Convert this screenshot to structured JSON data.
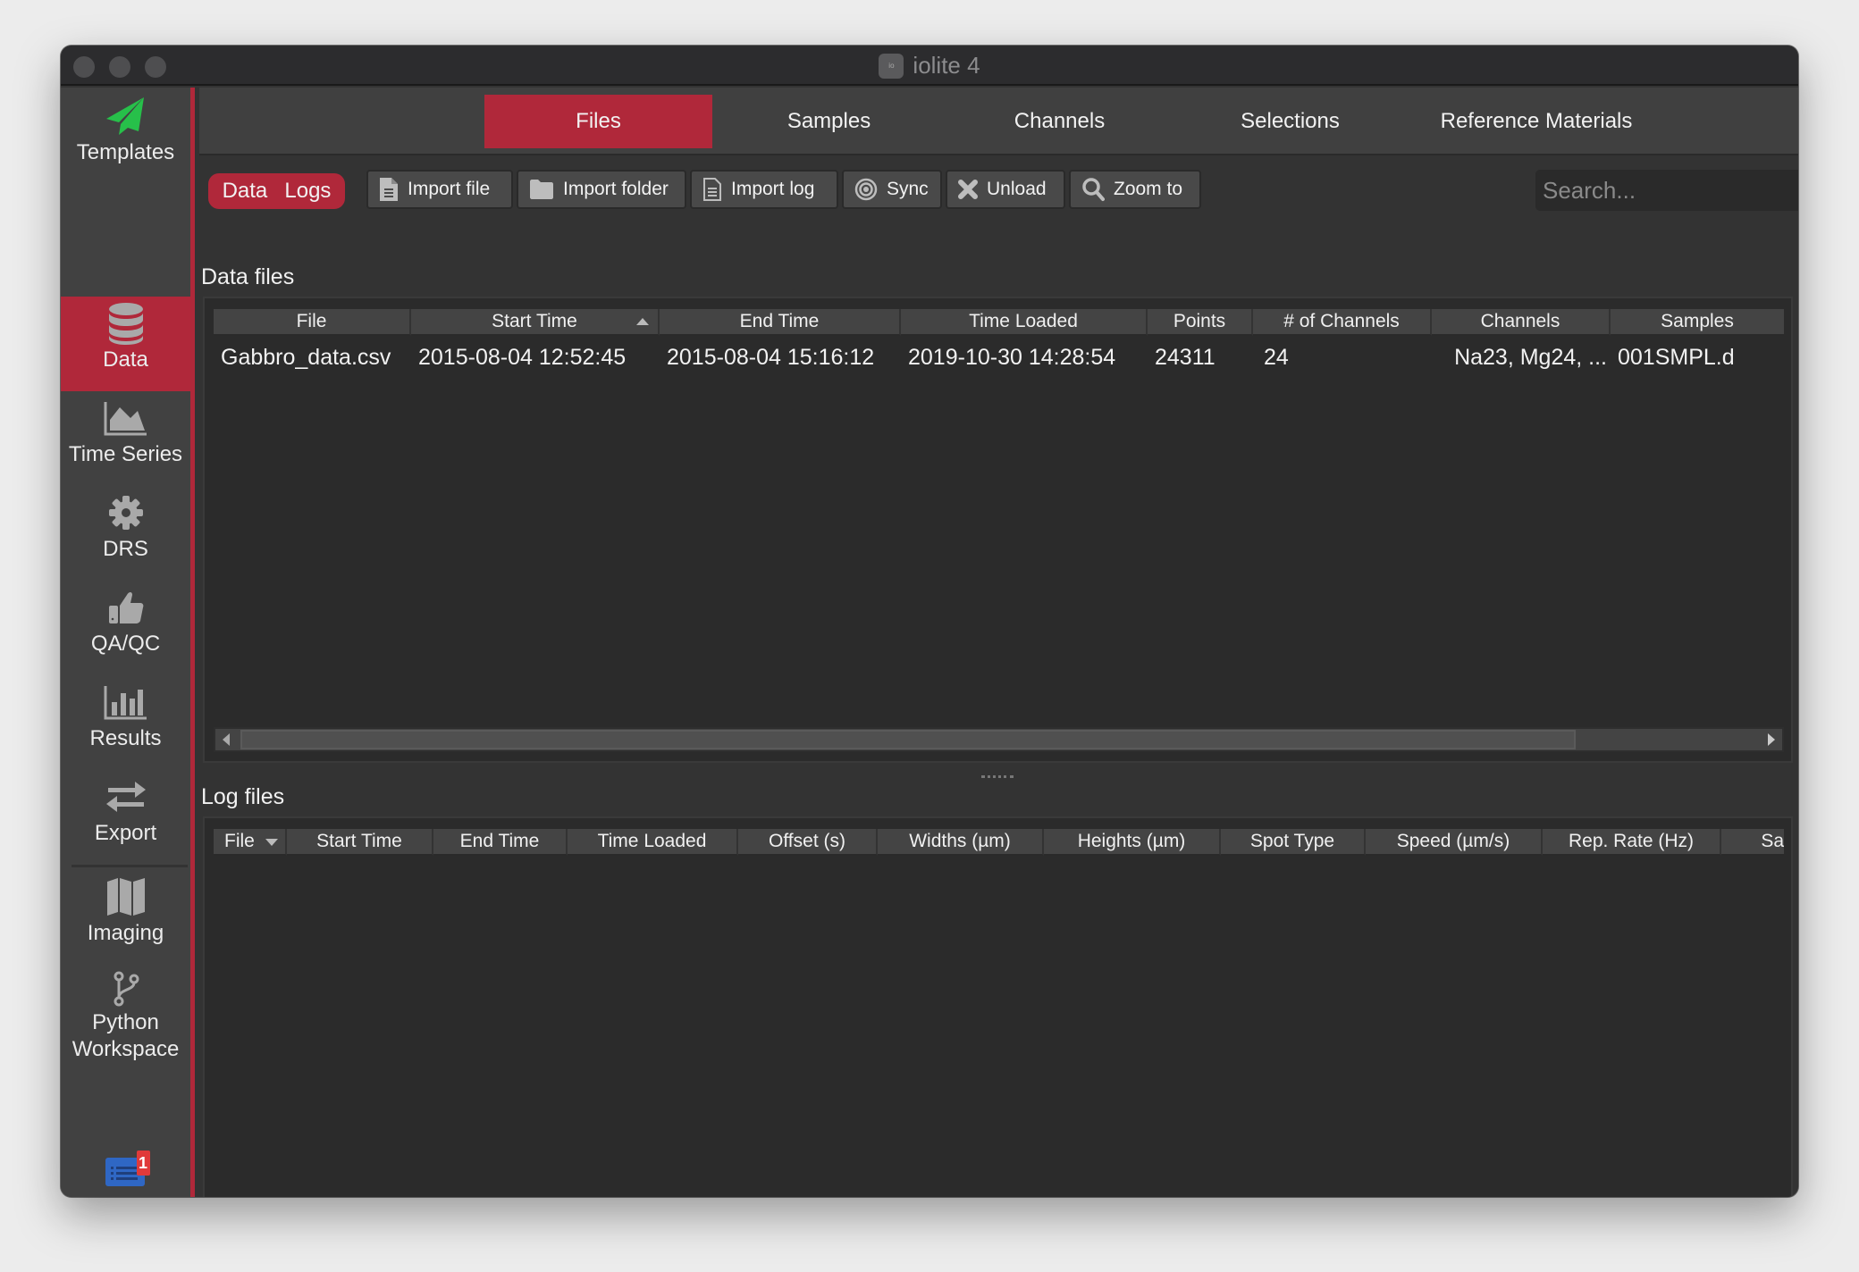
{
  "window": {
    "title": "iolite 4"
  },
  "sidebar": {
    "items": [
      {
        "id": "templates",
        "label": "Templates",
        "icon": "paper-plane-icon",
        "active": false
      },
      {
        "id": "data",
        "label": "Data",
        "icon": "database-icon",
        "active": true
      },
      {
        "id": "time-series",
        "label": "Time Series",
        "icon": "area-chart-icon",
        "active": false
      },
      {
        "id": "drs",
        "label": "DRS",
        "icon": "gear-icon",
        "active": false
      },
      {
        "id": "qaqc",
        "label": "QA/QC",
        "icon": "thumbs-up-icon",
        "active": false
      },
      {
        "id": "results",
        "label": "Results",
        "icon": "bar-chart-icon",
        "active": false
      },
      {
        "id": "export",
        "label": "Export",
        "icon": "exchange-arrows-icon",
        "active": false
      },
      {
        "id": "imaging",
        "label": "Imaging",
        "icon": "map-icon",
        "active": false
      },
      {
        "id": "python",
        "label": "Python Workspace",
        "label_line1": "Python",
        "label_line2": "Workspace",
        "icon": "code-branch-icon",
        "active": false
      },
      {
        "id": "messages",
        "label": "Messages",
        "icon": "message-list-icon",
        "badge": "1",
        "active": false
      }
    ],
    "accent": "#b0283a",
    "template_icon_color": "#27c04a",
    "messages_icon_color": "#2f67c4"
  },
  "tabs": [
    {
      "label": "Files",
      "active": true
    },
    {
      "label": "Samples",
      "active": false
    },
    {
      "label": "Channels",
      "active": false
    },
    {
      "label": "Selections",
      "active": false
    },
    {
      "label": "Reference Materials",
      "active": false
    }
  ],
  "toolbar": {
    "segment": {
      "data_label": "Data",
      "logs_label": "Logs"
    },
    "buttons": [
      {
        "label": "Import file",
        "icon": "file-icon"
      },
      {
        "label": "Import folder",
        "icon": "folder-icon"
      },
      {
        "label": "Import log",
        "icon": "file-lines-icon"
      },
      {
        "label": "Sync",
        "icon": "target-rings-icon"
      },
      {
        "label": "Unload",
        "icon": "x-icon"
      },
      {
        "label": "Zoom to",
        "icon": "magnifier-icon"
      }
    ],
    "search_placeholder": "Search...",
    "search_value": "",
    "regex_label": ".*"
  },
  "data_files": {
    "title": "Data files",
    "columns": [
      "File",
      "Start Time",
      "End Time",
      "Time Loaded",
      "Points",
      "# of Channels",
      "Channels",
      "Samples"
    ],
    "sort_column": "Start Time",
    "sort_direction": "ascending",
    "rows": [
      {
        "file": "Gabbro_data.csv",
        "start_time": "2015-08-04 12:52:45",
        "end_time": "2015-08-04 15:16:12",
        "time_loaded": "2019-10-30 14:28:54",
        "points": "24311",
        "num_channels": "24",
        "channels": "Na23, Mg24, ...",
        "samples": "001SMPL.d"
      }
    ]
  },
  "log_files": {
    "title": "Log files",
    "columns": [
      "File",
      "Start Time",
      "End Time",
      "Time Loaded",
      "Offset (s)",
      "Widths (µm)",
      "Heights (µm)",
      "Spot Type",
      "Speed (µm/s)",
      "Rep. Rate (Hz)",
      "Sa"
    ],
    "sort_column": "File",
    "sort_direction": "descending",
    "rows": []
  }
}
